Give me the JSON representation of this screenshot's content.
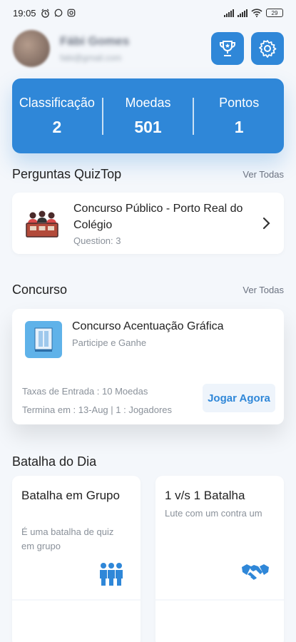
{
  "status_bar": {
    "time": "19:05",
    "icons": [
      "alarm-icon",
      "whatsapp-icon",
      "instagram-icon"
    ],
    "battery": "29"
  },
  "header": {
    "user_name": "Fábi Gomes",
    "user_sub": "fabi@gmail.com",
    "trophy_icon": "trophy-icon",
    "settings_icon": "gear-icon"
  },
  "stats": [
    {
      "label": "Classificação",
      "value": "2"
    },
    {
      "label": "Moedas",
      "value": "501"
    },
    {
      "label": "Pontos",
      "value": "1"
    }
  ],
  "quiz_section": {
    "title": "Perguntas QuizTop",
    "see_all": "Ver Todas",
    "item": {
      "title": "Concurso Público - Porto Real do Colégio",
      "meta": "Question: 3"
    }
  },
  "contest_section": {
    "title": "Concurso",
    "see_all": "Ver Todas",
    "item": {
      "title": "Concurso Acentuação Gráfica",
      "subtitle": "Participe e Ganhe",
      "fee": "Taxas de Entrada : 10 Moedas",
      "ends": "Termina em : 13-Aug  |  1 : Jogadores",
      "play_label": "Jogar Agora"
    }
  },
  "battle_section": {
    "title": "Batalha do Dia",
    "cards": [
      {
        "title": "Batalha em Grupo",
        "desc": "É uma batalha de quiz em grupo"
      },
      {
        "title": "1 v/s 1 Batalha",
        "desc": "Lute com um contra um"
      }
    ]
  },
  "colors": {
    "accent": "#2f87d8",
    "background": "#f4f7fb"
  }
}
